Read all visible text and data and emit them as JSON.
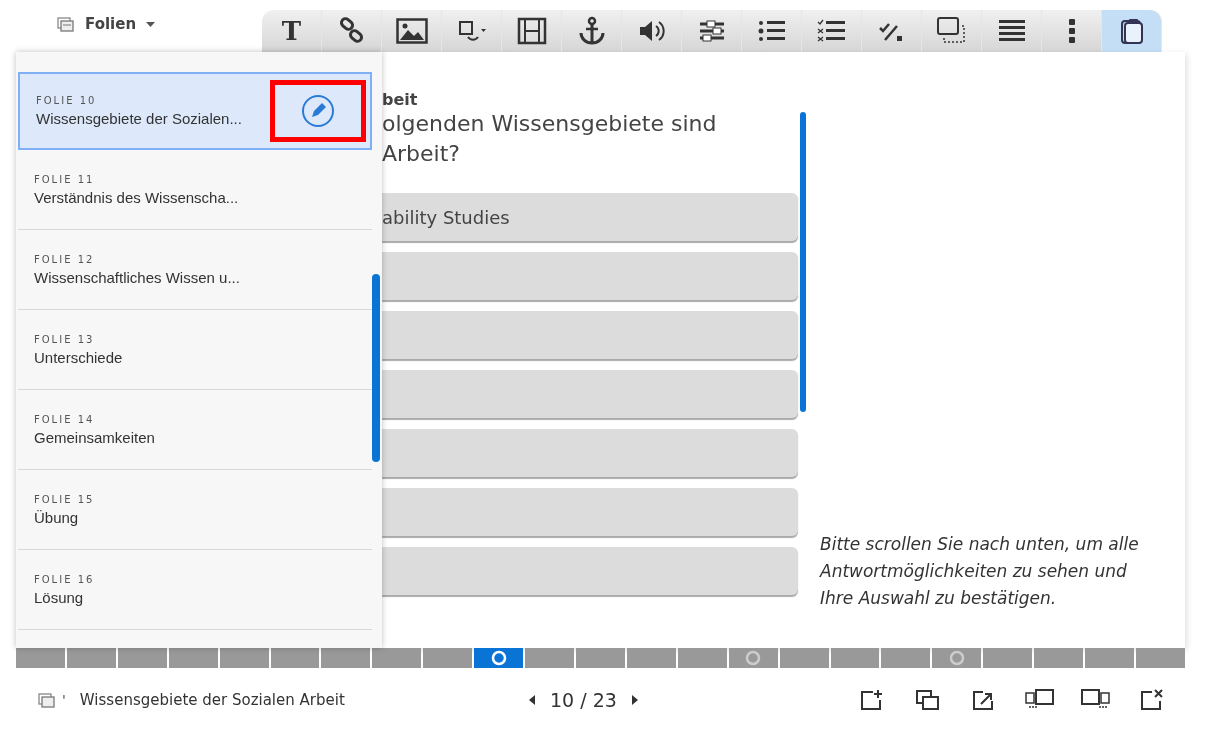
{
  "top_bar": {
    "menu_label": "Folien"
  },
  "toolbar": [
    {
      "kind": "text",
      "glyph": "T",
      "selected": false
    },
    {
      "kind": "link",
      "selected": false
    },
    {
      "kind": "image",
      "selected": false
    },
    {
      "kind": "shape",
      "selected": false
    },
    {
      "kind": "video",
      "selected": false
    },
    {
      "kind": "anchor",
      "selected": false
    },
    {
      "kind": "audio",
      "selected": false
    },
    {
      "kind": "sliders",
      "selected": false
    },
    {
      "kind": "list",
      "selected": false
    },
    {
      "kind": "checklist",
      "selected": false
    },
    {
      "kind": "check",
      "selected": false
    },
    {
      "kind": "overlay",
      "selected": false
    },
    {
      "kind": "lines",
      "selected": false
    },
    {
      "kind": "more",
      "selected": false
    },
    {
      "kind": "clipboard",
      "selected": true
    }
  ],
  "slides_panel": {
    "items": [
      {
        "label": "FOLIE 10",
        "title": "Wissensgebiete der Sozialen...",
        "selected": true,
        "editable": true,
        "highlighted": true
      },
      {
        "label": "FOLIE 11",
        "title": "Verständnis des Wissenscha...",
        "selected": false,
        "editable": false,
        "highlighted": false
      },
      {
        "label": "FOLIE 12",
        "title": "Wissenschaftliches Wissen u...",
        "selected": false,
        "editable": false,
        "highlighted": false
      },
      {
        "label": "FOLIE 13",
        "title": "Unterschiede",
        "selected": false,
        "editable": false,
        "highlighted": false
      },
      {
        "label": "FOLIE 14",
        "title": "Gemeinsamkeiten",
        "selected": false,
        "editable": false,
        "highlighted": false
      },
      {
        "label": "FOLIE 15",
        "title": "Übung",
        "selected": false,
        "editable": false,
        "highlighted": false
      },
      {
        "label": "FOLIE 16",
        "title": "Lösung",
        "selected": false,
        "editable": false,
        "highlighted": false
      }
    ]
  },
  "slide": {
    "title": "beit",
    "question": [
      "olgenden Wissensgebiete sind",
      "Arbeit?"
    ],
    "options": [
      {
        "kind": "text",
        "text": "ability Studies"
      },
      {
        "kind": "blank"
      },
      {
        "kind": "blank"
      },
      {
        "kind": "blank"
      },
      {
        "kind": "blank"
      },
      {
        "kind": "blank"
      },
      {
        "kind": "blank"
      }
    ],
    "note": "Bitte scrollen Sie nach unten, um alle Antwortmöglichkeiten zu sehen und Ihre Auswahl zu bestätigen."
  },
  "progress": [
    {
      "current": false,
      "marked": false
    },
    {
      "current": false,
      "marked": false
    },
    {
      "current": false,
      "marked": false
    },
    {
      "current": false,
      "marked": false
    },
    {
      "current": false,
      "marked": false
    },
    {
      "current": false,
      "marked": false
    },
    {
      "current": false,
      "marked": false
    },
    {
      "current": false,
      "marked": false
    },
    {
      "current": false,
      "marked": false
    },
    {
      "current": true,
      "marked": true
    },
    {
      "current": false,
      "marked": false
    },
    {
      "current": false,
      "marked": false
    },
    {
      "current": false,
      "marked": false
    },
    {
      "current": false,
      "marked": false
    },
    {
      "current": false,
      "marked": true
    },
    {
      "current": false,
      "marked": false
    },
    {
      "current": false,
      "marked": false
    },
    {
      "current": false,
      "marked": false
    },
    {
      "current": false,
      "marked": true
    },
    {
      "current": false,
      "marked": false
    },
    {
      "current": false,
      "marked": false
    },
    {
      "current": false,
      "marked": false
    },
    {
      "current": false,
      "marked": false
    }
  ],
  "status_bar": {
    "mark": "'",
    "title": "Wissensgebiete der Sozialen Arbeit",
    "pager": "10 / 23",
    "actions": [
      {
        "kind": "add"
      },
      {
        "kind": "duplicate"
      },
      {
        "kind": "export"
      },
      {
        "kind": "swap-left"
      },
      {
        "kind": "swap-right"
      },
      {
        "kind": "delete"
      }
    ]
  }
}
